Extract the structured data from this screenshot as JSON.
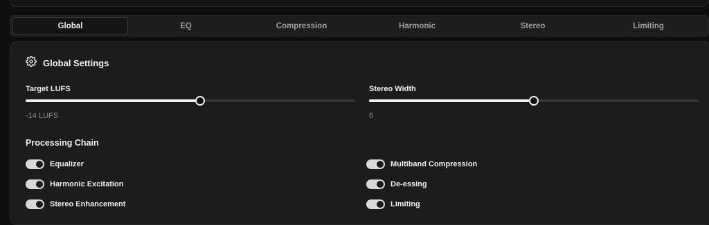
{
  "tabs": [
    {
      "label": "Global",
      "active": true
    },
    {
      "label": "EQ",
      "active": false
    },
    {
      "label": "Compression",
      "active": false
    },
    {
      "label": "Harmonic",
      "active": false
    },
    {
      "label": "Stereo",
      "active": false
    },
    {
      "label": "Limiting",
      "active": false
    }
  ],
  "panel": {
    "title": "Global Settings",
    "title_icon": "gear-icon"
  },
  "sliders": {
    "target_lufs": {
      "label": "Target LUFS",
      "value_text": "-14 LUFS",
      "fraction": 0.53
    },
    "stereo_width": {
      "label": "Stereo Width",
      "value_text": "6",
      "fraction": 0.5
    }
  },
  "processing_chain": {
    "title": "Processing Chain",
    "left": [
      {
        "label": "Equalizer",
        "on": true
      },
      {
        "label": "Harmonic Excitation",
        "on": true
      },
      {
        "label": "Stereo Enhancement",
        "on": true
      }
    ],
    "right": [
      {
        "label": "Multiband Compression",
        "on": true
      },
      {
        "label": "De-essing",
        "on": true
      },
      {
        "label": "Limiting",
        "on": true
      }
    ]
  },
  "colors": {
    "background": "#0e0e0e",
    "card": "#1c1c1c",
    "accent": "#f0f0f0"
  }
}
